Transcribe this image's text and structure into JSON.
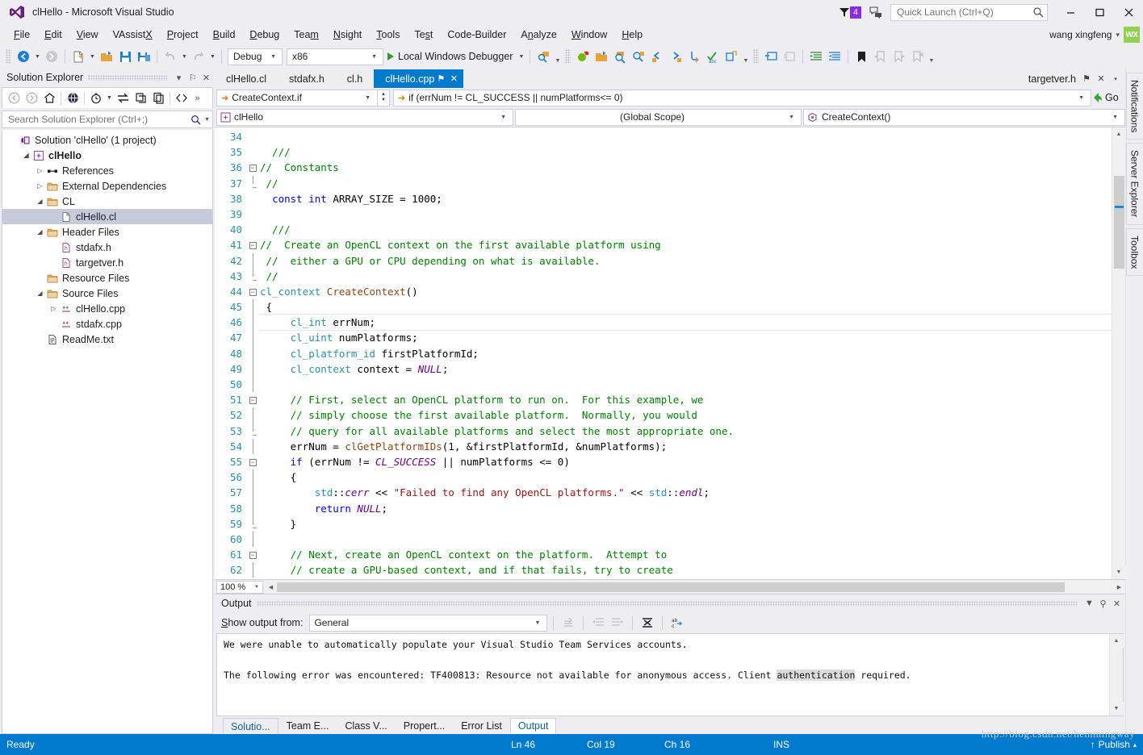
{
  "window": {
    "title": "clHello - Microsoft Visual Studio",
    "notifications_count": "4",
    "minimize": "–",
    "maximize": "❐",
    "close": "✕"
  },
  "quick_launch": {
    "placeholder": "Quick Launch (Ctrl+Q)"
  },
  "account": {
    "name": "wang xingfeng",
    "caret": "▾",
    "initials": "WX"
  },
  "menu": [
    {
      "label": "File",
      "accel": "F"
    },
    {
      "label": "Edit",
      "accel": "E"
    },
    {
      "label": "View",
      "accel": "V"
    },
    {
      "label": "VAssistX",
      "accel": "X"
    },
    {
      "label": "Project",
      "accel": "P"
    },
    {
      "label": "Build",
      "accel": "B"
    },
    {
      "label": "Debug",
      "accel": "D"
    },
    {
      "label": "Team",
      "accel": "m"
    },
    {
      "label": "Nsight",
      "accel": "N"
    },
    {
      "label": "Tools",
      "accel": "T"
    },
    {
      "label": "Test",
      "accel": "s"
    },
    {
      "label": "Code-Builder",
      "accel": ""
    },
    {
      "label": "Analyze",
      "accel": "n"
    },
    {
      "label": "Window",
      "accel": "W"
    },
    {
      "label": "Help",
      "accel": "H"
    }
  ],
  "toolbar": {
    "configuration": "Debug",
    "platform": "x86",
    "run_label": "Local Windows Debugger",
    "caret": "▾",
    "overflow": "▾"
  },
  "solution_explorer": {
    "title": "Solution Explorer",
    "search_placeholder": "Search Solution Explorer (Ctrl+;)",
    "dropdown": "▾",
    "pin": "⚐",
    "close": "✕",
    "overflow": "»",
    "tree": [
      {
        "label": "Solution 'clHello' (1 project)",
        "indent": 0,
        "expander": "",
        "icon": "solution-icon",
        "bold": false,
        "selected": false
      },
      {
        "label": "clHello",
        "indent": 1,
        "expander": "◢",
        "icon": "project-icon",
        "bold": true,
        "selected": false
      },
      {
        "label": "References",
        "indent": 2,
        "expander": "▷",
        "icon": "references-icon",
        "bold": false,
        "selected": false
      },
      {
        "label": "External Dependencies",
        "indent": 2,
        "expander": "▷",
        "icon": "folder-icon",
        "bold": false,
        "selected": false
      },
      {
        "label": "CL",
        "indent": 2,
        "expander": "◢",
        "icon": "folder-icon",
        "bold": false,
        "selected": false
      },
      {
        "label": "clHello.cl",
        "indent": 3,
        "expander": "",
        "icon": "file-icon",
        "bold": false,
        "selected": true
      },
      {
        "label": "Header Files",
        "indent": 2,
        "expander": "◢",
        "icon": "folder-icon",
        "bold": false,
        "selected": false
      },
      {
        "label": "stdafx.h",
        "indent": 3,
        "expander": "",
        "icon": "header-icon",
        "bold": false,
        "selected": false
      },
      {
        "label": "targetver.h",
        "indent": 3,
        "expander": "",
        "icon": "header-icon",
        "bold": false,
        "selected": false
      },
      {
        "label": "Resource Files",
        "indent": 2,
        "expander": "",
        "icon": "folder-icon",
        "bold": false,
        "selected": false
      },
      {
        "label": "Source Files",
        "indent": 2,
        "expander": "◢",
        "icon": "folder-icon",
        "bold": false,
        "selected": false
      },
      {
        "label": "clHello.cpp",
        "indent": 3,
        "expander": "▷",
        "icon": "cpp-icon",
        "bold": false,
        "selected": false
      },
      {
        "label": "stdafx.cpp",
        "indent": 3,
        "expander": "",
        "icon": "cpp-icon",
        "bold": false,
        "selected": false
      },
      {
        "label": "ReadMe.txt",
        "indent": 2,
        "expander": "",
        "icon": "text-icon",
        "bold": false,
        "selected": false
      }
    ]
  },
  "editor": {
    "tabs": [
      {
        "label": "clHello.cl",
        "active": false
      },
      {
        "label": "stdafx.h",
        "active": false
      },
      {
        "label": "cl.h",
        "active": false
      },
      {
        "label": "clHello.cpp",
        "active": true
      }
    ],
    "tab_pin": "⚑",
    "tab_close": "✕",
    "right_tab": "targetver.h",
    "right_tab_pin": "⚑",
    "right_tab_close": "✕",
    "right_tab_caret": "▾",
    "nav": {
      "bookmark_combo": "CreateContext.if",
      "expression": "if (errNum != CL_SUCCESS || numPlatforms<= 0)",
      "go_label": "Go",
      "project_combo": "clHello",
      "scope_combo": "(Global Scope)",
      "member_combo": "CreateContext()"
    },
    "zoom": "100 %",
    "first_line": 34,
    "lines": [
      {
        "n": 34,
        "fold": "",
        "bar": false,
        "cur": false,
        "tokens": []
      },
      {
        "n": 35,
        "fold": "",
        "bar": false,
        "cur": false,
        "tokens": [
          {
            "t": "  ///",
            "c": "cm"
          }
        ]
      },
      {
        "n": 36,
        "fold": "minus",
        "bar": false,
        "cur": false,
        "tokens": [
          {
            "t": "//  Constants",
            "c": "cm"
          }
        ]
      },
      {
        "n": 37,
        "fold": "bar-end",
        "bar": false,
        "cur": false,
        "tokens": [
          {
            "t": " //",
            "c": "cm"
          }
        ]
      },
      {
        "n": 38,
        "fold": "",
        "bar": false,
        "cur": false,
        "tokens": [
          {
            "t": "  ",
            "c": "pl"
          },
          {
            "t": "const",
            "c": "kw"
          },
          {
            "t": " ",
            "c": "pl"
          },
          {
            "t": "int",
            "c": "kw"
          },
          {
            "t": " ARRAY_SIZE = 1000;",
            "c": "pl"
          }
        ]
      },
      {
        "n": 39,
        "fold": "",
        "bar": false,
        "cur": false,
        "tokens": []
      },
      {
        "n": 40,
        "fold": "",
        "bar": false,
        "cur": false,
        "tokens": [
          {
            "t": "  ///",
            "c": "cm"
          }
        ]
      },
      {
        "n": 41,
        "fold": "minus",
        "bar": false,
        "cur": false,
        "tokens": [
          {
            "t": "//  Create an OpenCL context on the first available platform using",
            "c": "cm"
          }
        ]
      },
      {
        "n": 42,
        "fold": "bar",
        "bar": true,
        "cur": false,
        "tokens": [
          {
            "t": " //  either a GPU or CPU depending on what is available.",
            "c": "cm"
          }
        ]
      },
      {
        "n": 43,
        "fold": "bar-end",
        "bar": false,
        "cur": false,
        "tokens": [
          {
            "t": " //",
            "c": "cm"
          }
        ]
      },
      {
        "n": 44,
        "fold": "minus",
        "bar": false,
        "cur": false,
        "tokens": [
          {
            "t": "cl_context",
            "c": "ty"
          },
          {
            "t": " ",
            "c": "pl"
          },
          {
            "t": "CreateContext",
            "c": "fn"
          },
          {
            "t": "()",
            "c": "pl"
          }
        ]
      },
      {
        "n": 45,
        "fold": "bar",
        "bar": true,
        "cur": false,
        "tokens": [
          {
            "t": " {",
            "c": "pl"
          }
        ]
      },
      {
        "n": 46,
        "fold": "bar",
        "bar": true,
        "cur": true,
        "tokens": [
          {
            "t": "     ",
            "c": "pl"
          },
          {
            "t": "cl_int",
            "c": "ty"
          },
          {
            "t": " errNum;",
            "c": "pl"
          }
        ]
      },
      {
        "n": 47,
        "fold": "bar",
        "bar": true,
        "cur": false,
        "tokens": [
          {
            "t": "     ",
            "c": "pl"
          },
          {
            "t": "cl_uint",
            "c": "ty"
          },
          {
            "t": " numPlatforms;",
            "c": "pl"
          }
        ]
      },
      {
        "n": 48,
        "fold": "bar",
        "bar": true,
        "cur": false,
        "tokens": [
          {
            "t": "     ",
            "c": "pl"
          },
          {
            "t": "cl_platform_id",
            "c": "ty"
          },
          {
            "t": " firstPlatformId;",
            "c": "pl"
          }
        ]
      },
      {
        "n": 49,
        "fold": "bar",
        "bar": true,
        "cur": false,
        "tokens": [
          {
            "t": "     ",
            "c": "pl"
          },
          {
            "t": "cl_context",
            "c": "ty"
          },
          {
            "t": " context = ",
            "c": "pl"
          },
          {
            "t": "NULL",
            "c": "mac"
          },
          {
            "t": ";",
            "c": "pl"
          }
        ]
      },
      {
        "n": 50,
        "fold": "bar",
        "bar": true,
        "cur": false,
        "tokens": []
      },
      {
        "n": 51,
        "fold": "minus-in",
        "bar": true,
        "cur": false,
        "tokens": [
          {
            "t": "     // First, select an OpenCL platform to run on.  For this example, we",
            "c": "cm"
          }
        ]
      },
      {
        "n": 52,
        "fold": "bar2",
        "bar": true,
        "cur": false,
        "tokens": [
          {
            "t": "     // simply choose the first available platform.  Normally, you would",
            "c": "cm"
          }
        ]
      },
      {
        "n": 53,
        "fold": "bar2-end",
        "bar": true,
        "cur": false,
        "tokens": [
          {
            "t": "     // query for all available platforms and select the most appropriate one.",
            "c": "cm"
          }
        ]
      },
      {
        "n": 54,
        "fold": "bar",
        "bar": true,
        "cur": false,
        "tokens": [
          {
            "t": "     errNum = ",
            "c": "pl"
          },
          {
            "t": "clGetPlatformIDs",
            "c": "fn"
          },
          {
            "t": "(1, &firstPlatformId, &numPlatforms);",
            "c": "pl"
          }
        ]
      },
      {
        "n": 55,
        "fold": "minus-in",
        "bar": true,
        "cur": false,
        "tokens": [
          {
            "t": "     ",
            "c": "pl"
          },
          {
            "t": "if",
            "c": "kw"
          },
          {
            "t": " (errNum != ",
            "c": "pl"
          },
          {
            "t": "CL_SUCCESS",
            "c": "mac"
          },
          {
            "t": " || numPlatforms <= 0)",
            "c": "pl"
          }
        ]
      },
      {
        "n": 56,
        "fold": "bar2",
        "bar": true,
        "cur": false,
        "tokens": [
          {
            "t": "     {",
            "c": "pl"
          }
        ]
      },
      {
        "n": 57,
        "fold": "bar2",
        "bar": true,
        "cur": false,
        "tokens": [
          {
            "t": "         ",
            "c": "pl"
          },
          {
            "t": "std",
            "c": "ty"
          },
          {
            "t": "::",
            "c": "pl"
          },
          {
            "t": "cerr",
            "c": "mac"
          },
          {
            "t": " << ",
            "c": "pl"
          },
          {
            "t": "\"Failed to find any OpenCL platforms.\"",
            "c": "str"
          },
          {
            "t": " << ",
            "c": "pl"
          },
          {
            "t": "std",
            "c": "ty"
          },
          {
            "t": "::",
            "c": "pl"
          },
          {
            "t": "endl",
            "c": "mac"
          },
          {
            "t": ";",
            "c": "pl"
          }
        ]
      },
      {
        "n": 58,
        "fold": "bar2",
        "bar": true,
        "cur": false,
        "tokens": [
          {
            "t": "         ",
            "c": "pl"
          },
          {
            "t": "return",
            "c": "kw"
          },
          {
            "t": " ",
            "c": "pl"
          },
          {
            "t": "NULL",
            "c": "mac"
          },
          {
            "t": ";",
            "c": "pl"
          }
        ]
      },
      {
        "n": 59,
        "fold": "bar2-end",
        "bar": true,
        "cur": false,
        "tokens": [
          {
            "t": "     }",
            "c": "pl"
          }
        ]
      },
      {
        "n": 60,
        "fold": "bar",
        "bar": true,
        "cur": false,
        "tokens": []
      },
      {
        "n": 61,
        "fold": "minus-in",
        "bar": true,
        "cur": false,
        "tokens": [
          {
            "t": "     // Next, create an OpenCL context on the platform.  Attempt to",
            "c": "cm"
          }
        ]
      },
      {
        "n": 62,
        "fold": "bar2",
        "bar": true,
        "cur": false,
        "tokens": [
          {
            "t": "     // create a GPU-based context, and if that fails, try to create",
            "c": "cm"
          }
        ]
      }
    ]
  },
  "output": {
    "title": "Output",
    "show_from_label": "Show output from:",
    "show_from_value": "General",
    "combo_caret": "▾",
    "lines": [
      {
        "text": "We were unable to automatically populate your Visual Studio Team Services accounts.",
        "highlight": ""
      },
      {
        "text": "",
        "highlight": ""
      },
      {
        "text": "The following error was encountered: TF400813: Resource not available for anonymous access. Client ",
        "highlight": "authentication",
        "tail": " required."
      }
    ]
  },
  "bottom_tabs": [
    {
      "label": "Solutio...",
      "state": "sel-left"
    },
    {
      "label": "Team E...",
      "state": ""
    },
    {
      "label": "Class V...",
      "state": ""
    },
    {
      "label": "Propert...",
      "state": ""
    },
    {
      "label": "Error List",
      "state": ""
    },
    {
      "label": "Output",
      "state": "active"
    }
  ],
  "status_bar": {
    "ready": "Ready",
    "line": "Ln 46",
    "column": "Col 19",
    "character": "Ch 16",
    "insert_mode": "INS",
    "publish": "Publish",
    "publish_arrow": "↑",
    "publish_caret": "▴"
  },
  "right_dock": [
    {
      "label": "Notifications"
    },
    {
      "label": "Server Explorer"
    },
    {
      "label": "Toolbox"
    }
  ],
  "watermark": "http://blog.csdn.net/hemmingway",
  "colors": {
    "accent": "#007acc",
    "title_bar": "#eeeef2",
    "badge": "#8a2be2",
    "avatar": "#92d050",
    "comment": "#008000",
    "keyword": "#0000ff",
    "type": "#2b91af",
    "macro": "#6f008a",
    "string": "#a31515",
    "function": "#8b4513"
  }
}
